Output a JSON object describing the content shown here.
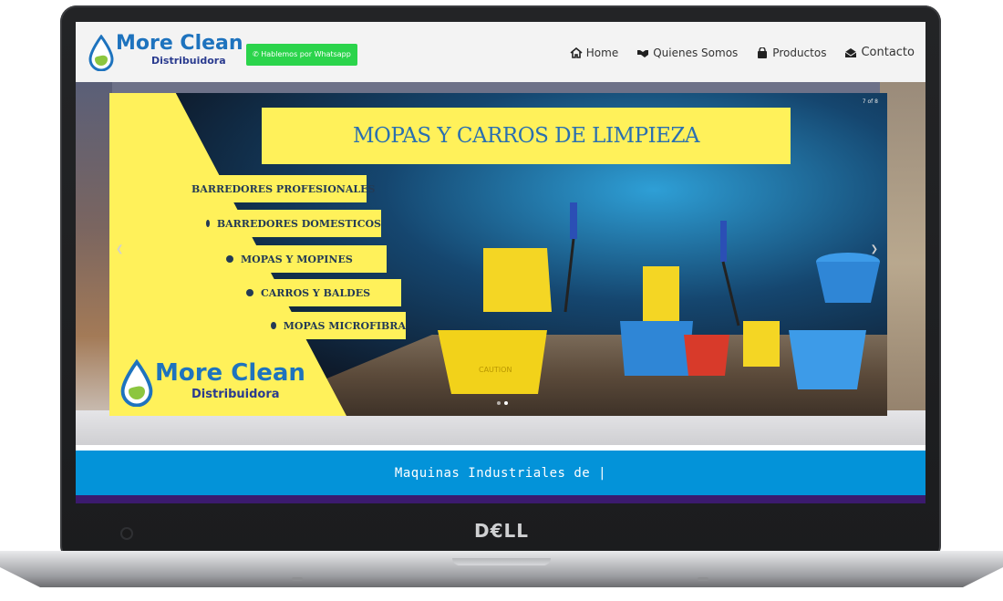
{
  "device": {
    "brand_label": "D€LL"
  },
  "site": {
    "logo": {
      "name": "More Clean",
      "sub": "Distribuidora"
    },
    "whatsapp_button": "Hablemos por Whatsapp",
    "menu": [
      {
        "label": "Home",
        "icon": "home-icon"
      },
      {
        "label": "Quienes Somos",
        "icon": "handshake-icon"
      },
      {
        "label": "Productos",
        "icon": "shopping-bag-icon"
      },
      {
        "label": "Contacto",
        "icon": "envelope-open-icon"
      }
    ]
  },
  "slider": {
    "counter": "7 of 8",
    "title": "MOPAS Y CARROS DE LIMPIEZA",
    "bullets": [
      "BARREDORES PROFESIONALES",
      "BARREDORES DOMESTICOS",
      "MOPAS Y MOPINES",
      "CARROS Y BALDES",
      "MOPAS MICROFIBRA"
    ],
    "logo": {
      "name": "More Clean",
      "sub": "Distribuidora"
    }
  },
  "typing_strip": {
    "text": "Maquinas Industriales de |"
  },
  "colors": {
    "brand_blue": "#1e73be",
    "whatsapp_green": "#2bd44b",
    "banner_yellow": "#fff15a",
    "strip_blue": "#0393d9",
    "strip_purple": "#3b1a6e"
  }
}
